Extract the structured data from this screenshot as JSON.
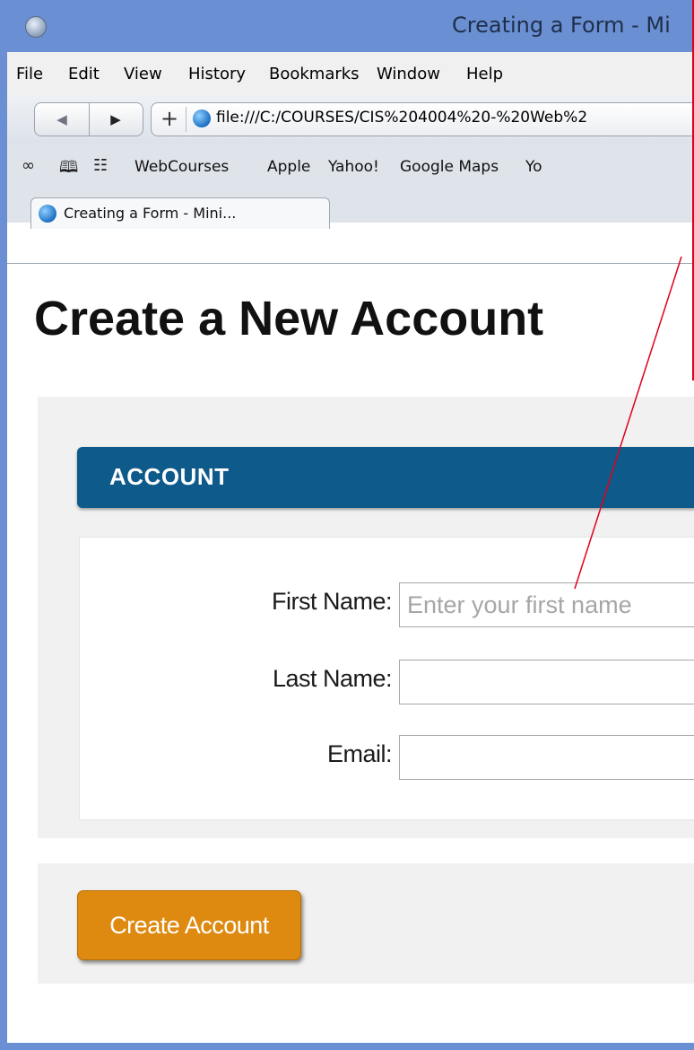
{
  "window": {
    "title": "Creating a Form - Mi"
  },
  "menubar": {
    "items": [
      "File",
      "Edit",
      "View",
      "History",
      "Bookmarks",
      "Window",
      "Help"
    ]
  },
  "toolbar": {
    "back_icon": "◀",
    "forward_icon": "▶",
    "add_icon": "+",
    "url": "file:///C:/COURSES/CIS%204004%20-%20Web%2"
  },
  "bookmarks": {
    "icons": [
      "reading-glasses-icon",
      "book-icon",
      "grid-icon"
    ],
    "items": [
      "WebCourses",
      "Apple",
      "Yahoo!",
      "Google Maps",
      "Yo"
    ]
  },
  "tabs": [
    {
      "label": "Creating a Form - Mini..."
    }
  ],
  "page": {
    "title": "Create a New Account",
    "account_header": "ACCOUNT",
    "fields": [
      {
        "label": "First Name:",
        "value": "",
        "placeholder": "Enter your first name"
      },
      {
        "label": "Last Name:",
        "value": "",
        "placeholder": ""
      },
      {
        "label": "Email:",
        "value": "",
        "placeholder": ""
      }
    ],
    "submit_label": "Create Account"
  },
  "colors": {
    "section_header": "#0e5a8a",
    "submit_button": "#de8a10",
    "annotation": "#e0001b",
    "window_frame": "#6a8fd2"
  }
}
